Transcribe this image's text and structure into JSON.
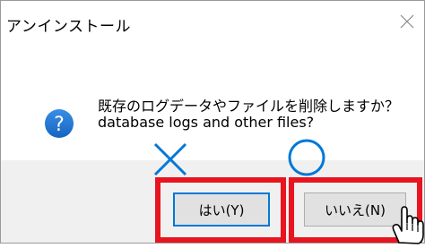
{
  "window": {
    "title": "アンインストール",
    "close_icon": "close-icon"
  },
  "message": {
    "icon": "question-icon",
    "line1": "既存のログデータやファイルを削除しますか？",
    "line2": "database logs and other files?"
  },
  "buttons": {
    "yes_label": "はい(Y)",
    "no_label": "いいえ(N)"
  },
  "annotations": {
    "x_mark_icon": "cross-mark-icon",
    "circle_mark_icon": "circle-mark-icon",
    "highlight_color": "#e8141f",
    "mark_color": "#0078d7",
    "cursor_icon": "hand-cursor-icon"
  }
}
